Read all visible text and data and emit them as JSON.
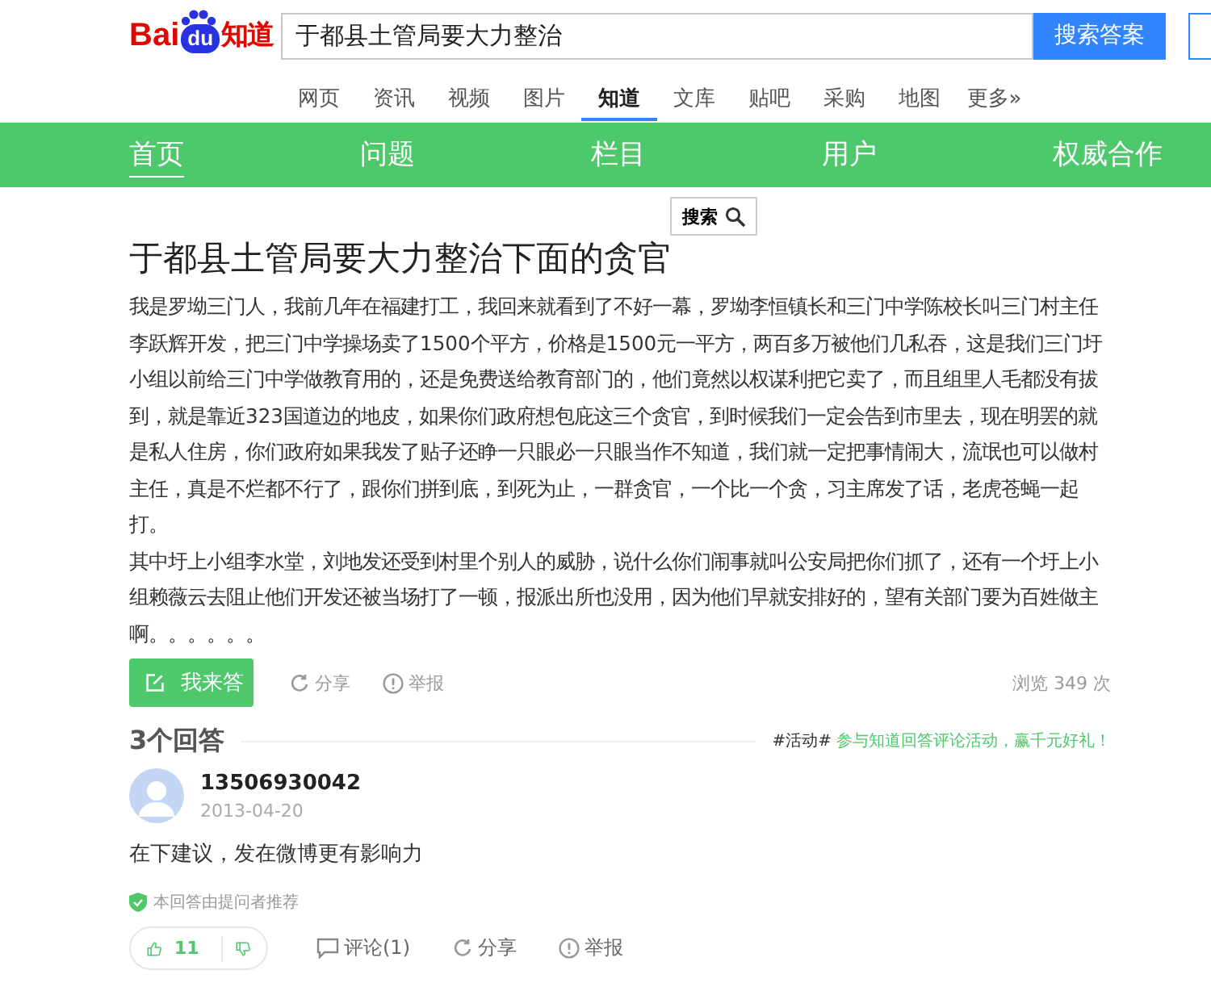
{
  "logo": {
    "parts": [
      "Bai",
      "du",
      "知道"
    ]
  },
  "search": {
    "value": "于都县土管局要大力整治",
    "button": "搜索答案"
  },
  "nav_tabs": [
    {
      "label": "网页",
      "selected": false
    },
    {
      "label": "资讯",
      "selected": false
    },
    {
      "label": "视频",
      "selected": false
    },
    {
      "label": "图片",
      "selected": false
    },
    {
      "label": "知道",
      "selected": true
    },
    {
      "label": "文库",
      "selected": false
    },
    {
      "label": "贴吧",
      "selected": false
    },
    {
      "label": "采购",
      "selected": false
    },
    {
      "label": "地图",
      "selected": false
    },
    {
      "label": "更多»",
      "selected": false
    }
  ],
  "green_nav": [
    {
      "label": "首页",
      "selected": true
    },
    {
      "label": "问题",
      "selected": false
    },
    {
      "label": "栏目",
      "selected": false
    },
    {
      "label": "用户",
      "selected": false
    },
    {
      "label": "权威合作",
      "selected": false
    }
  ],
  "floating_search": {
    "label": "搜索"
  },
  "question": {
    "title": "于都县土管局要大力整治下面的贪官",
    "paragraphs": [
      "我是罗坳三门人，我前几年在福建打工，我回来就看到了不好一幕，罗坳李恒镇长和三门中学陈校长叫三门村主任李跃辉开发，把三门中学操场卖了1500个平方，价格是1500元一平方，两百多万被他们几私吞，这是我们三门圩小组以前给三门中学做教育用的，还是免费送给教育部门的，他们竟然以权谋利把它卖了，而且组里人毛都没有拔到，就是靠近323国道边的地皮，如果你们政府想包庇这三个贪官，到时候我们一定会告到市里去，现在明罢的就是私人住房，你们政府如果我发了贴子还睁一只眼必一只眼当作不知道，我们就一定把事情闹大，流氓也可以做村主任，真是不烂都不行了，跟你们拼到底，到死为止，一群贪官，一个比一个贪，习主席发了话，老虎苍蝇一起打。",
      "其中圩上小组李水堂，刘地发还受到村里个别人的威胁，说什么你们闹事就叫公安局把你们抓了，还有一个圩上小组赖薇云去阻止他们开发还被当场打了一顿，报派出所也没用，因为他们早就安排好的，望有关部门要为百姓做主啊。。。。。。"
    ],
    "answer_button": "我来答",
    "actions": [
      {
        "kind": "share",
        "label": "分享"
      },
      {
        "kind": "report",
        "label": "举报"
      }
    ],
    "views": "浏览 349 次"
  },
  "answers_header": {
    "count": "3个回答",
    "tag": "#活动#",
    "promo": "参与知道回答评论活动，赢千元好礼！"
  },
  "answers": [
    {
      "user": "13506930042",
      "date": "2013-04-20",
      "text": "在下建议，发在微博更有影响力",
      "badge": "本回答由提问者推荐",
      "upvotes": "11",
      "actions": [
        {
          "kind": "comment",
          "label": "评论(1)"
        },
        {
          "kind": "share",
          "label": "分享"
        },
        {
          "kind": "report",
          "label": "举报"
        }
      ]
    }
  ]
}
